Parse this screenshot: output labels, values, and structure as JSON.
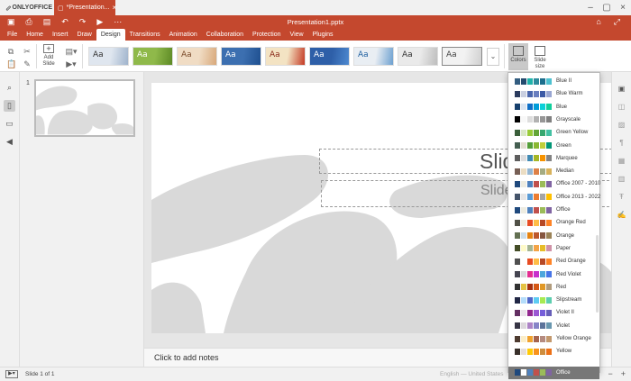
{
  "app": {
    "name": "ONLYOFFICE",
    "doc_tab": "*Presentation...",
    "doc_title": "Presentation1.pptx"
  },
  "menu": [
    "File",
    "Home",
    "Insert",
    "Draw",
    "Design",
    "Transitions",
    "Animation",
    "Collaboration",
    "Protection",
    "View",
    "Plugins"
  ],
  "ribbon": {
    "add_slide": "Add Slide",
    "colors": "Colors",
    "slide_size": "Slide size",
    "theme_label": "Aa"
  },
  "themes": [
    {
      "bg": "#dfe6ef",
      "fg": "#333333",
      "accent": "#9fb3cc"
    },
    {
      "bg": "#8fb94a",
      "fg": "#ffffff",
      "accent": "#5d8a25"
    },
    {
      "bg": "#f0dcc4",
      "fg": "#7a4a2a",
      "accent": "#d8a87a"
    },
    {
      "bg": "#3c6fb0",
      "fg": "#ffffff",
      "accent": "#1e4f8f"
    },
    {
      "bg": "#f3e3c3",
      "fg": "#8a2a1a",
      "accent": "#c43a24"
    },
    {
      "bg": "#2e5fa8",
      "fg": "#ffffff",
      "accent": "#4d89d0"
    },
    {
      "bg": "#e9eef3",
      "fg": "#1f5f9f",
      "accent": "#6ca0d0"
    },
    {
      "bg": "#eaeaea",
      "fg": "#333333",
      "accent": "#bdbdbd"
    },
    {
      "bg": "#f2f2f2",
      "fg": "#444444",
      "accent": "#d0d0d0"
    }
  ],
  "slide_panel": {
    "number": "1"
  },
  "slide": {
    "title": "Slid",
    "subtitle": "Slide"
  },
  "notes": {
    "placeholder": "Click to add notes"
  },
  "status": {
    "slide_of": "Slide 1 of 1",
    "language": "English — United States"
  },
  "color_schemes": [
    {
      "name": "Blue II",
      "colors": [
        "#335d80",
        "#244b6e",
        "#20b2aa",
        "#2d8a9c",
        "#1c6e8c",
        "#4ec1d0"
      ]
    },
    {
      "name": "Blue Warm",
      "colors": [
        "#2b3b5e",
        "#c9cfe0",
        "#4a66ac",
        "#6a7fbf",
        "#3c5aa6",
        "#99a6d2"
      ]
    },
    {
      "name": "Blue",
      "colors": [
        "#17406d",
        "#dbe5f1",
        "#0f6fc6",
        "#009dd9",
        "#0bd0d9",
        "#10cf9b"
      ]
    },
    {
      "name": "Grayscale",
      "colors": [
        "#000000",
        "#f8f8f8",
        "#dddddd",
        "#b2b2b2",
        "#969696",
        "#808080"
      ]
    },
    {
      "name": "Green Yellow",
      "colors": [
        "#3a5f3a",
        "#d9e7c7",
        "#99cb38",
        "#63a537",
        "#37a76f",
        "#44c1a3"
      ]
    },
    {
      "name": "Green",
      "colors": [
        "#455f51",
        "#e3ded1",
        "#549e39",
        "#8ab833",
        "#c0cf3a",
        "#029676"
      ]
    },
    {
      "name": "Marquee",
      "colors": [
        "#5e5e5e",
        "#ddddde",
        "#418ab3",
        "#a6b727",
        "#f69200",
        "#838383"
      ]
    },
    {
      "name": "Median",
      "colors": [
        "#775f55",
        "#ebddc3",
        "#94b6d2",
        "#dd8047",
        "#a5ab81",
        "#d8b25c"
      ]
    },
    {
      "name": "Office 2007 - 2010",
      "colors": [
        "#1f497d",
        "#eeece1",
        "#4f81bd",
        "#c0504d",
        "#9bbb59",
        "#8064a2"
      ]
    },
    {
      "name": "Office 2013 - 2022",
      "colors": [
        "#44546a",
        "#e7e6e6",
        "#5b9bd5",
        "#ed7d31",
        "#a5a5a5",
        "#ffc000"
      ]
    },
    {
      "name": "Office",
      "colors": [
        "#1f497d",
        "#eeece1",
        "#4f81bd",
        "#c0504d",
        "#9bbb59",
        "#8064a2"
      ]
    },
    {
      "name": "Orange Red",
      "colors": [
        "#505046",
        "#eeece1",
        "#e84c22",
        "#ffbd47",
        "#b64926",
        "#ff8427"
      ]
    },
    {
      "name": "Orange",
      "colors": [
        "#637052",
        "#ccddea",
        "#e48312",
        "#bd582c",
        "#865640",
        "#9b8357"
      ]
    },
    {
      "name": "Paper",
      "colors": [
        "#444d26",
        "#fefac9",
        "#a5b592",
        "#f3a447",
        "#e7bc29",
        "#d092a7"
      ]
    },
    {
      "name": "Red Orange",
      "colors": [
        "#505050",
        "#ffffff",
        "#e84c22",
        "#ffbd47",
        "#b64926",
        "#ff8427"
      ]
    },
    {
      "name": "Red Violet",
      "colors": [
        "#454551",
        "#d8d9dc",
        "#e32d91",
        "#c830cc",
        "#4ea6dc",
        "#4775e7"
      ]
    },
    {
      "name": "Red",
      "colors": [
        "#323232",
        "#e5c243",
        "#a5300f",
        "#d55816",
        "#e19825",
        "#b19c7d"
      ]
    },
    {
      "name": "Slipstream",
      "colors": [
        "#212745",
        "#b4dcfa",
        "#4e67c8",
        "#5eccf3",
        "#a7ea52",
        "#5dceaf"
      ]
    },
    {
      "name": "Violet II",
      "colors": [
        "#632e62",
        "#eae5eb",
        "#92278f",
        "#9b57d3",
        "#755dd9",
        "#665eb8"
      ]
    },
    {
      "name": "Violet",
      "colors": [
        "#373545",
        "#dcd8dc",
        "#ad84c6",
        "#8784c7",
        "#5d739a",
        "#6997af"
      ]
    },
    {
      "name": "Yellow Orange",
      "colors": [
        "#4e3b30",
        "#fbeec9",
        "#f0a22e",
        "#a5644e",
        "#b58b80",
        "#c3986d"
      ]
    },
    {
      "name": "Yellow",
      "colors": [
        "#39302a",
        "#e5dedb",
        "#ffca08",
        "#f8931d",
        "#ce8d3e",
        "#ec7016"
      ]
    },
    {
      "name": "Office",
      "colors": [
        "#1f497d",
        "#ffffff",
        "#4f81bd",
        "#c0504d",
        "#9bbb59",
        "#8064a2"
      ],
      "selected": true
    }
  ]
}
